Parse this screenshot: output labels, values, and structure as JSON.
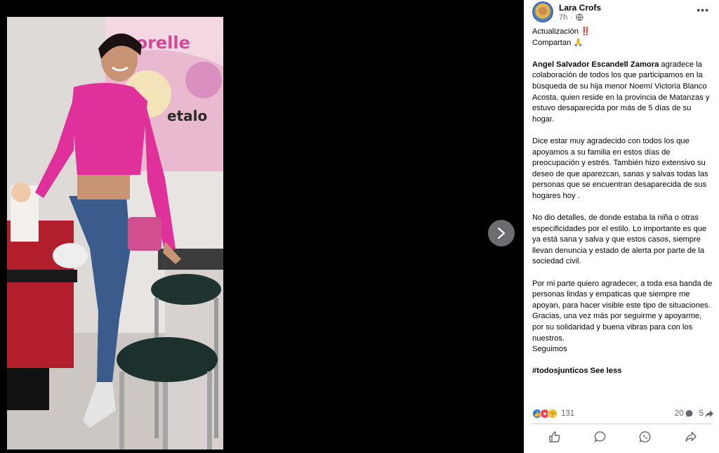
{
  "post": {
    "author": "Lara Crofs",
    "time": "7h",
    "privacy_icon": "globe-icon",
    "more_label": "•••"
  },
  "photo": {
    "sign_text": "onorelle",
    "sign_text2": "etalo"
  },
  "text": {
    "line1": "Actualización ‼️",
    "line2": "Compartan 🙏",
    "p1_bold": "Angel Salvador Escandell Zamora",
    "p1_rest": " agradece la colaboración de todos los que participamos en la búsqueda de su hija menor Noemí Victoria Blanco Acosta, quien reside en la provincia de Matanzas y estuvo desaparecida por más de 5 días de su hogar.",
    "p2": "Dice estar muy agradecido con todos los que apoyamos a su familia en estos días de preocupación y estrés. También hizo extensivo su deseo de que aparezcan, sanas y salvas todas las personas que se encuentran desaparecida de sus hogares hoy .",
    "p3": "No dio detalles, de donde estaba la niña o otras especificidades por el estilo. Lo importante es que ya está sana y salva y que estos casos, siempre llevan denuncia y estado de alerta por parte de la sociedad civil.",
    "p4a": "Por mi parte quiero agradecer, a toda esa banda de personas lindas y empaticas que siempre me apoyan, para hacer visible este tipo de situaciones.",
    "p4b": "Gracias, una vez más por seguirme y apoyarme, por su solidaridad y buena vibras para con los nuestros.",
    "p4c": "Seguimos",
    "hashtag": "#todosjunticos",
    "see_less": "See less"
  },
  "stats": {
    "reaction_count": "131",
    "comment_count": "20",
    "share_count": "5"
  },
  "colors": {
    "like": "#1877f2",
    "love": "#f33e58",
    "care": "#f7b125",
    "shirt": "#e0309a"
  }
}
